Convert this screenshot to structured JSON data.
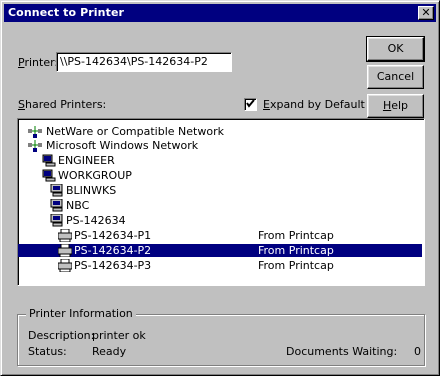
{
  "window": {
    "title": "Connect to Printer",
    "close_glyph": "✕"
  },
  "form": {
    "printer_label_prefix": "",
    "printer_label_accel": "P",
    "printer_label_rest": "rinter:",
    "printer_value": "\\\\PS-142634\\PS-142634-P2",
    "shared_label_accel": "S",
    "shared_label_rest": "hared Printers:",
    "expand_checked": true,
    "expand_label_accel": "E",
    "expand_label_rest": "xpand by Default"
  },
  "buttons": {
    "ok": "OK",
    "cancel": "Cancel",
    "help_accel": "H",
    "help_rest": "elp"
  },
  "tree": [
    {
      "label": "NetWare or Compatible Network",
      "icon": "network-icon",
      "level": 0,
      "col2": ""
    },
    {
      "label": "Microsoft Windows Network",
      "icon": "network-icon",
      "level": 0,
      "col2": ""
    },
    {
      "label": "ENGINEER",
      "icon": "workgroup-icon",
      "level": 1,
      "col2": ""
    },
    {
      "label": "WORKGROUP",
      "icon": "workgroup-icon",
      "level": 1,
      "col2": ""
    },
    {
      "label": "BLINWKS",
      "icon": "computer-icon",
      "level": 2,
      "col2": ""
    },
    {
      "label": "NBC",
      "icon": "computer-icon",
      "level": 2,
      "col2": ""
    },
    {
      "label": "PS-142634",
      "icon": "computer-icon",
      "level": 2,
      "col2": ""
    },
    {
      "label": "PS-142634-P1",
      "icon": "printer-icon",
      "level": 3,
      "col2": "From Printcap"
    },
    {
      "label": "PS-142634-P2",
      "icon": "printer-icon",
      "level": 3,
      "col2": "From Printcap",
      "selected": true
    },
    {
      "label": "PS-142634-P3",
      "icon": "printer-icon",
      "level": 3,
      "col2": "From Printcap"
    }
  ],
  "printer_info": {
    "title": "Printer Information",
    "description_label": "Description:",
    "description_value": "printer ok",
    "status_label": "Status:",
    "status_value": "Ready",
    "docs_label": "Documents Waiting:",
    "docs_value": "0"
  },
  "colors": {
    "titlebar": "#000080",
    "face": "#c0c0c0",
    "selection": "#000080"
  }
}
